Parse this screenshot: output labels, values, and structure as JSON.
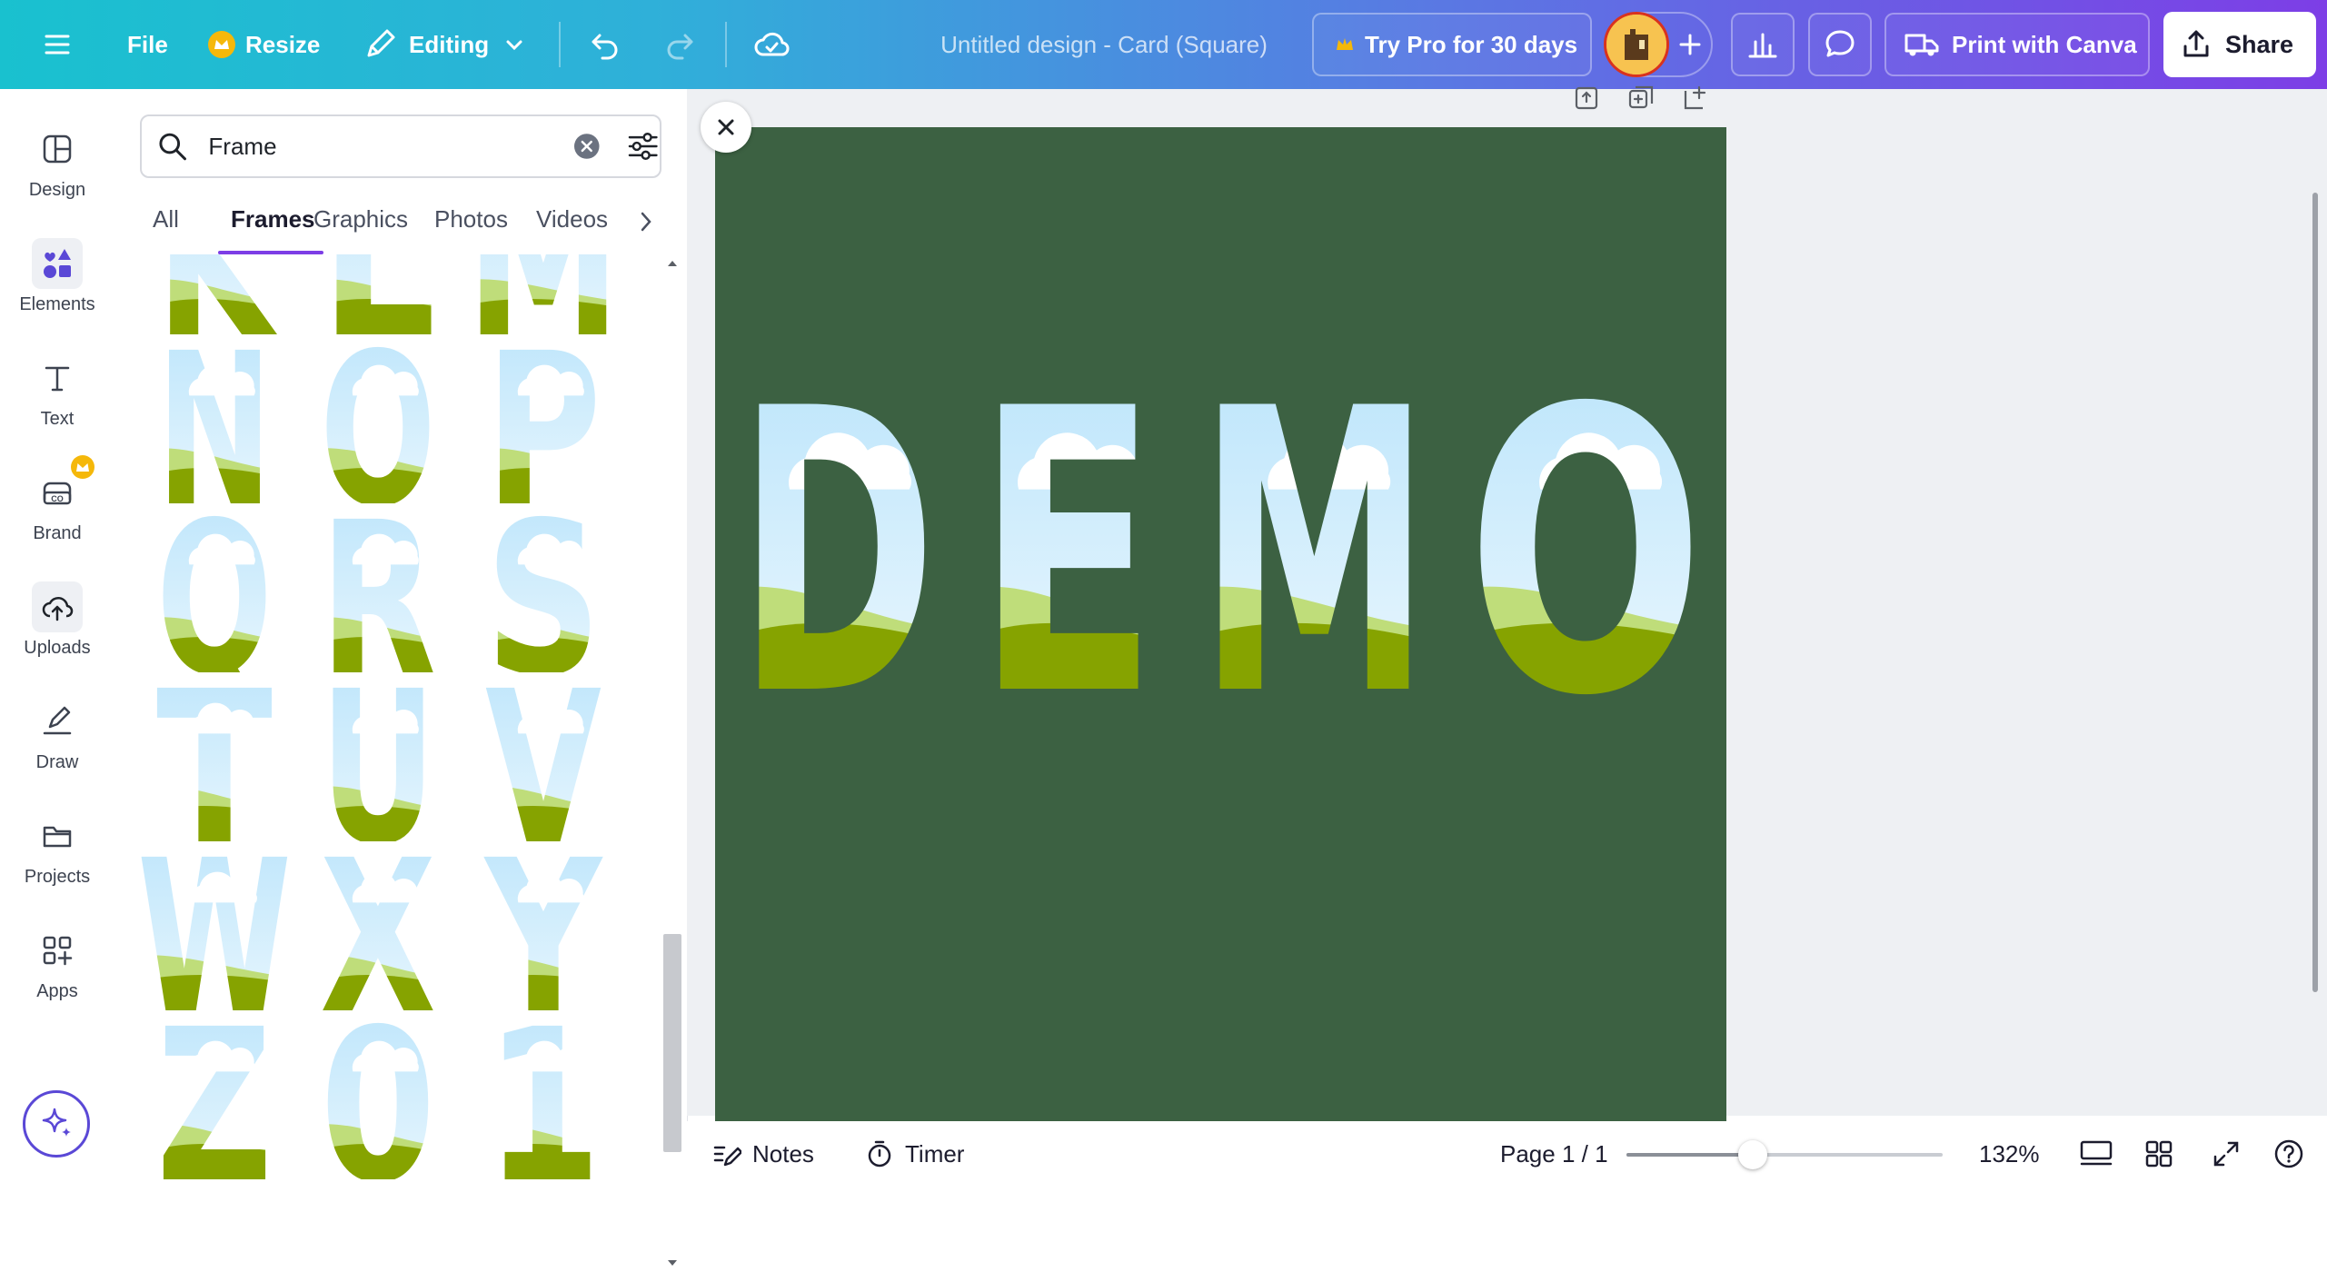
{
  "topbar": {
    "file_label": "File",
    "resize_label": "Resize",
    "editing_label": "Editing",
    "design_title": "Untitled design - Card (Square)",
    "pro_label": "Try Pro for 30 days",
    "print_label": "Print with Canva",
    "share_label": "Share"
  },
  "leftnav": {
    "items": [
      {
        "label": "Design",
        "icon": "layout-icon"
      },
      {
        "label": "Elements",
        "icon": "shapes-icon"
      },
      {
        "label": "Text",
        "icon": "text-t-icon"
      },
      {
        "label": "Brand",
        "icon": "brand-kit-icon"
      },
      {
        "label": "Uploads",
        "icon": "cloud-upload-icon"
      },
      {
        "label": "Draw",
        "icon": "pen-icon"
      },
      {
        "label": "Projects",
        "icon": "folder-icon"
      },
      {
        "label": "Apps",
        "icon": "apps-grid-icon"
      }
    ]
  },
  "panel": {
    "search_value": "Frame",
    "tabs": [
      "All",
      "Frames",
      "Graphics",
      "Photos",
      "Videos"
    ],
    "active_tab": "Frames",
    "frame_glyphs": [
      "K",
      "L",
      "M",
      "N",
      "O",
      "P",
      "Q",
      "R",
      "S",
      "T",
      "U",
      "V",
      "W",
      "X",
      "Y",
      "Z",
      "0",
      "1"
    ]
  },
  "canvas": {
    "text": "DEMO",
    "letters": [
      "D",
      "E",
      "M",
      "O"
    ],
    "background_color": "#3c6142"
  },
  "bottombar": {
    "notes_label": "Notes",
    "timer_label": "Timer",
    "page_label": "Page 1 / 1",
    "zoom_label": "132%",
    "zoom_percent": 132,
    "zoom_slider_fraction": 0.4
  },
  "colors": {
    "sky": "#c8ebfb",
    "hill_light": "#bfdd7a",
    "hill_dark": "#86a300",
    "accent": "#7d3ee6"
  }
}
